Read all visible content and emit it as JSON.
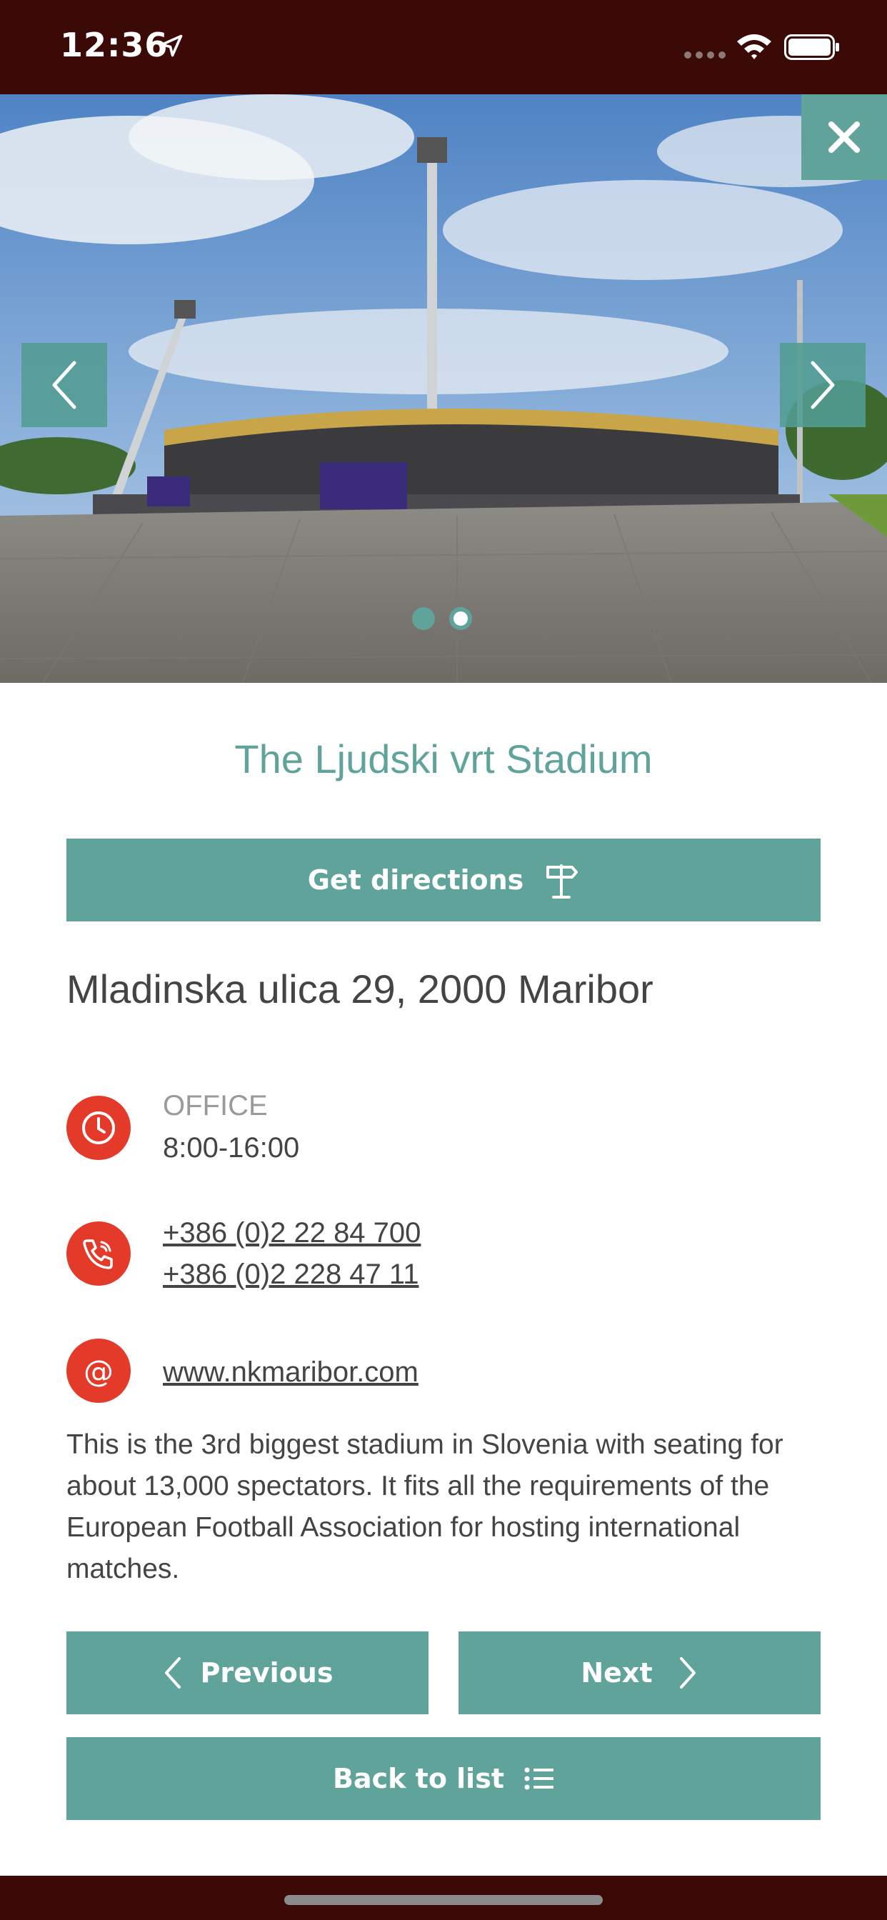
{
  "status_bar": {
    "time": "12:36"
  },
  "gallery": {
    "slide_count": 2,
    "active_index": 0
  },
  "title": "The Ljudski vrt Stadium",
  "directions_button": {
    "label": "Get directions"
  },
  "address": "Mladinska ulica 29, 2000 Maribor",
  "office": {
    "label": "OFFICE",
    "hours": "8:00-16:00"
  },
  "phones": [
    "+386 (0)2 22 84 700",
    "+386 (0)2 228 47 11"
  ],
  "website": "www.nkmaribor.com",
  "description": "This is the 3rd biggest stadium in Slovenia with seating for about 13,000 spectators. It fits all the requirements of the European Football Association for hosting international matches.",
  "nav": {
    "previous_label": "Previous",
    "next_label": "Next",
    "back_label": "Back to list"
  },
  "colors": {
    "accent": "#5fa39b",
    "icon_red": "#e33a2a",
    "status_bar": "#3b0a07"
  }
}
